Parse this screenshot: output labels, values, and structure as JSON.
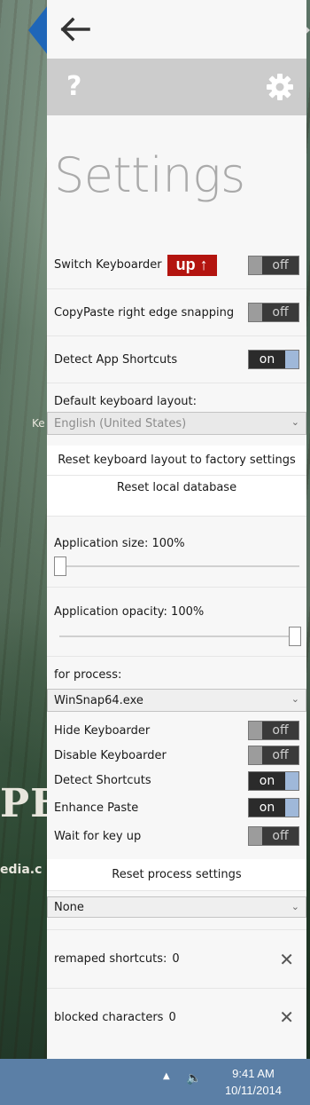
{
  "header": {
    "back_icon": "arrow-left-icon",
    "help_icon": "question-mark-icon",
    "settings_icon": "gear-icon"
  },
  "title": "Settings",
  "switch_keyboarder": {
    "label": "Switch Keyboarder",
    "badge": "up ↑",
    "state": "off"
  },
  "copypaste": {
    "label": "CopyPaste right edge snapping",
    "state": "off"
  },
  "detect_app_shortcuts": {
    "label": "Detect App Shortcuts",
    "state": "on"
  },
  "layout": {
    "label": "Default keyboard layout:",
    "value": "English (United States)"
  },
  "reset_layout_button": "Reset keyboard layout to factory settings",
  "reset_db_button": "Reset local database",
  "app_size": {
    "label": "Application size: 100%",
    "value": 1.0
  },
  "app_opacity": {
    "label": "Application opacity: 100%",
    "value": 1.0
  },
  "process": {
    "label": "for process:",
    "value": "WinSnap64.exe"
  },
  "process_toggles": [
    {
      "label": "Hide Keyboarder",
      "state": "off"
    },
    {
      "label": "Disable Keyboarder",
      "state": "off"
    },
    {
      "label": "Detect Shortcuts",
      "state": "on"
    },
    {
      "label": "Enhance Paste",
      "state": "on"
    },
    {
      "label": "Wait for key up",
      "state": "off"
    }
  ],
  "reset_process_button": "Reset process settings",
  "none_select": "None",
  "remaped": {
    "label": "remaped shortcuts:",
    "count": "0"
  },
  "blocked": {
    "label": "blocked characters",
    "count": "0"
  },
  "background": {
    "text1": "Ke",
    "text2": "PED",
    "text3": "edia.c"
  },
  "taskbar": {
    "time": "9:41 AM",
    "date": "10/11/2014"
  },
  "colors": {
    "accent_blue": "#1f66b8",
    "badge_red": "#b3140f",
    "toggle_on": "#9fb8d9",
    "taskbar": "#5b7fa6"
  }
}
